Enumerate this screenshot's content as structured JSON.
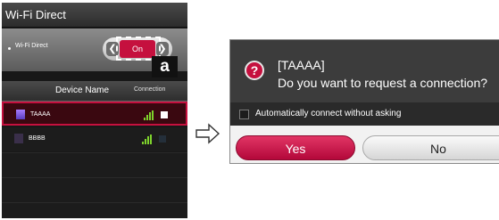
{
  "phone": {
    "title": "Wi-Fi Direct",
    "wifi_direct_label": "Wi-Fi Direct",
    "toggle": {
      "value": "On",
      "left_arrow": "❮",
      "right_arrow": "❯"
    },
    "callout": "a",
    "list_header": {
      "device_name": "Device Name",
      "connection": "Connection"
    },
    "devices": [
      {
        "name": "TAAAA",
        "selected": true,
        "connected": true
      },
      {
        "name": "BBBB",
        "selected": false,
        "connected": false
      }
    ]
  },
  "dialog": {
    "icon": "question-icon",
    "icon_glyph": "?",
    "line1": "[TAAAA]",
    "line2": "Do you want to request a connection?",
    "checkbox_label": "Automatically connect without asking",
    "yes_label": "Yes",
    "no_label": "No"
  },
  "colors": {
    "accent": "#c5103e",
    "signal": "#7ed32c"
  }
}
